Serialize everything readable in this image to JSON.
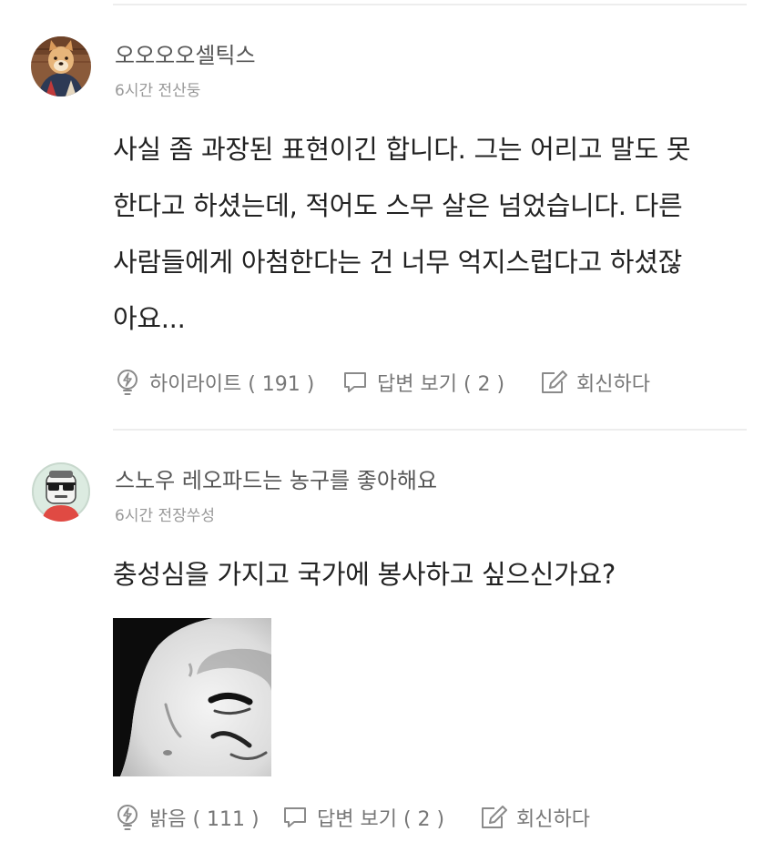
{
  "comments": [
    {
      "username": "오오오오셀틱스",
      "meta": "6시간 전산둥",
      "body_lines": [
        "사실 좀 과장된 표현이긴 합니다. 그는 어리고 말도 못",
        "한다고 하셨는데, 적어도 스무 살은 넘었습니다. 다른",
        "사람들에게 아첨한다는 건 너무 억지스럽다고 하셨잖",
        "아요..."
      ],
      "highlight_label": "하이라이트 ( 191 )",
      "reply_label": "답변 보기 ( 2 )",
      "reply_action_label": "회신하다",
      "avatar": "shiba-dog-avatar"
    },
    {
      "username": "스노우 레오파드는 농구를 좋아해요",
      "meta": "6시간 전장쑤성",
      "body_lines": [
        "충성심을 가지고 국가에 봉사하고 싶으신가요?"
      ],
      "highlight_label": "밝음 ( 111 )",
      "reply_label": "답변 보기 ( 2 )",
      "reply_action_label": "회신하다",
      "avatar": "sunglasses-character-avatar",
      "attachment": "meme-face-image"
    }
  ],
  "icons": {
    "highlight": "lightbulb-icon",
    "replies": "speech-bubble-icon",
    "reply": "edit-icon"
  },
  "colors": {
    "text": "#222222",
    "username": "#555555",
    "meta": "#999999",
    "action": "#777777",
    "divider": "#ededed"
  }
}
